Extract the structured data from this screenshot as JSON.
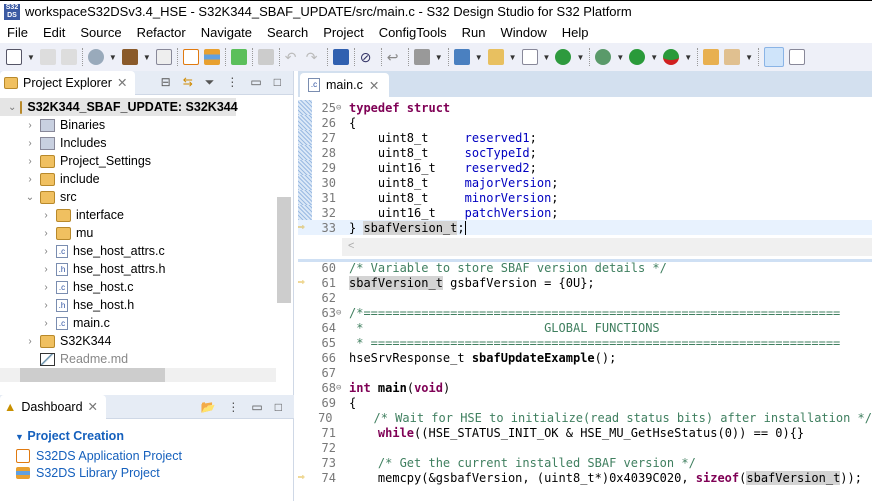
{
  "window": {
    "logo": "S32 DS",
    "title": "workspaceS32DSv3.4_HSE - S32K344_SBAF_UPDATE/src/main.c - S32 Design Studio for S32 Platform"
  },
  "menu": [
    "File",
    "Edit",
    "Source",
    "Refactor",
    "Navigate",
    "Search",
    "Project",
    "ConfigTools",
    "Run",
    "Window",
    "Help"
  ],
  "project_explorer": {
    "tab": "Project Explorer",
    "items": [
      {
        "label": "S32K344_SBAF_UPDATE: S32K344",
        "depth": 0,
        "expanded": true,
        "icon": "project-folder-icon",
        "bold": true
      },
      {
        "label": "Binaries",
        "depth": 1,
        "icon": "binaries-icon"
      },
      {
        "label": "Includes",
        "depth": 1,
        "icon": "includes-icon"
      },
      {
        "label": "Project_Settings",
        "depth": 1,
        "icon": "source-folder-icon"
      },
      {
        "label": "include",
        "depth": 1,
        "icon": "source-folder-icon"
      },
      {
        "label": "src",
        "depth": 1,
        "expanded": true,
        "icon": "source-folder-icon"
      },
      {
        "label": "interface",
        "depth": 2,
        "icon": "folder-icon"
      },
      {
        "label": "mu",
        "depth": 2,
        "icon": "folder-icon"
      },
      {
        "label": "hse_host_attrs.c",
        "depth": 2,
        "icon": "c-file-icon"
      },
      {
        "label": "hse_host_attrs.h",
        "depth": 2,
        "icon": "h-file-icon"
      },
      {
        "label": "hse_host.c",
        "depth": 2,
        "icon": "c-file-icon"
      },
      {
        "label": "hse_host.h",
        "depth": 2,
        "icon": "h-file-icon"
      },
      {
        "label": "main.c",
        "depth": 2,
        "icon": "c-file-icon"
      },
      {
        "label": "S32K344",
        "depth": 1,
        "icon": "folder-icon"
      },
      {
        "label": "Readme.md",
        "depth": 1,
        "icon": "markdown-file-icon",
        "leaf": true,
        "dim": true
      }
    ]
  },
  "dashboard": {
    "tab": "Dashboard",
    "section": "Project Creation",
    "links": [
      "S32DS Application Project",
      "S32DS Library Project"
    ]
  },
  "editor": {
    "tab": "main.c",
    "top_lines": [
      {
        "n": "25",
        "fold": true,
        "t": [
          [
            "typedef struct",
            "kw"
          ]
        ]
      },
      {
        "n": "26",
        "t": [
          [
            "{",
            ""
          ]
        ]
      },
      {
        "n": "27",
        "t": [
          [
            "    uint8_t     ",
            ""
          ],
          [
            "reserved1",
            "fld"
          ],
          [
            ";",
            ""
          ]
        ]
      },
      {
        "n": "28",
        "t": [
          [
            "    uint8_t     ",
            ""
          ],
          [
            "socTypeId",
            "fld"
          ],
          [
            ";",
            ""
          ]
        ]
      },
      {
        "n": "29",
        "t": [
          [
            "    uint16_t    ",
            ""
          ],
          [
            "reserved2",
            "fld"
          ],
          [
            ";",
            ""
          ]
        ]
      },
      {
        "n": "30",
        "t": [
          [
            "    uint8_t     ",
            ""
          ],
          [
            "majorVersion",
            "fld"
          ],
          [
            ";",
            ""
          ]
        ]
      },
      {
        "n": "31",
        "t": [
          [
            "    uint8_t     ",
            ""
          ],
          [
            "minorVersion",
            "fld"
          ],
          [
            ";",
            ""
          ]
        ]
      },
      {
        "n": "32",
        "t": [
          [
            "    uint16_t    ",
            ""
          ],
          [
            "patchVersion",
            "fld"
          ],
          [
            ";",
            ""
          ]
        ]
      },
      {
        "n": "33",
        "arrow": true,
        "current": true,
        "t": [
          [
            "} ",
            ""
          ],
          [
            "sbafVersion_t",
            "hl"
          ],
          [
            ";",
            ""
          ]
        ]
      }
    ],
    "bottom_lines": [
      {
        "n": "60",
        "t": [
          [
            "/* Variable to store SBAF version details */",
            "cm"
          ]
        ]
      },
      {
        "n": "61",
        "arrow": true,
        "t": [
          [
            "sbafVersion_t",
            "hl"
          ],
          [
            " gsbafVersion = {0U};",
            ""
          ]
        ]
      },
      {
        "n": "62",
        "t": []
      },
      {
        "n": "63",
        "fold": true,
        "t": [
          [
            "/*==================================================================",
            "cm"
          ]
        ]
      },
      {
        "n": "64",
        "t": [
          [
            " *                         GLOBAL FUNCTIONS",
            "cm"
          ]
        ]
      },
      {
        "n": "65",
        "t": [
          [
            " * =================================================================",
            "cm"
          ]
        ]
      },
      {
        "n": "66",
        "t": [
          [
            "hseSrvResponse_t ",
            ""
          ],
          [
            "sbafUpdateExample",
            "bold"
          ],
          [
            "();",
            ""
          ]
        ]
      },
      {
        "n": "67",
        "t": []
      },
      {
        "n": "68",
        "fold": true,
        "t": [
          [
            "int",
            "kw"
          ],
          [
            " ",
            ""
          ],
          [
            "main",
            "bold"
          ],
          [
            "(",
            ""
          ],
          [
            "void",
            "kw"
          ],
          [
            ")",
            ""
          ]
        ]
      },
      {
        "n": "69",
        "t": [
          [
            "{",
            ""
          ]
        ]
      },
      {
        "n": "70",
        "t": [
          [
            "    ",
            ""
          ],
          [
            "/* Wait for HSE to initialize(read status bits) after installation */",
            "cm"
          ]
        ]
      },
      {
        "n": "71",
        "t": [
          [
            "    ",
            ""
          ],
          [
            "while",
            "kw"
          ],
          [
            "((HSE_STATUS_INIT_OK & HSE_MU_GetHseStatus(0)) == 0){}",
            ""
          ]
        ]
      },
      {
        "n": "72",
        "t": []
      },
      {
        "n": "73",
        "t": [
          [
            "    ",
            ""
          ],
          [
            "/* Get the current installed SBAF version */",
            "cm"
          ]
        ]
      },
      {
        "n": "74",
        "arrow": true,
        "t": [
          [
            "    memcpy(&gsbafVersion, (uint8_t*)0x4039C020, ",
            ""
          ],
          [
            "sizeof",
            "kw"
          ],
          [
            "(",
            ""
          ],
          [
            "sbafVersion_t",
            "hl"
          ],
          [
            "));",
            ""
          ]
        ]
      }
    ]
  }
}
